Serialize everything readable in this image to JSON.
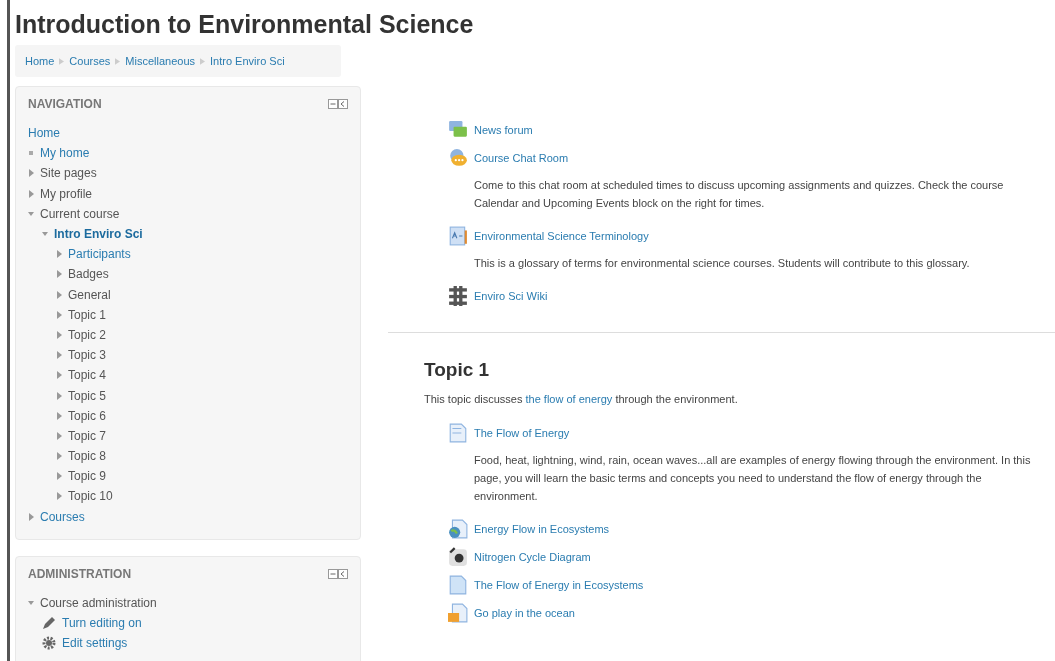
{
  "page_title": "Introduction to Environmental Science",
  "breadcrumb": [
    "Home",
    "Courses",
    "Miscellaneous",
    "Intro Enviro Sci"
  ],
  "navigation": {
    "title": "NAVIGATION",
    "items": [
      {
        "label": "Home",
        "link": true,
        "current": false
      },
      {
        "label": "My home",
        "link": true,
        "current": false
      },
      {
        "label": "Site pages",
        "link": false,
        "current": false,
        "expanded": false
      },
      {
        "label": "My profile",
        "link": false,
        "current": false,
        "expanded": false
      },
      {
        "label": "Current course",
        "link": false,
        "current": false,
        "expanded": true,
        "children": [
          {
            "label": "Intro Enviro Sci",
            "link": true,
            "current": true,
            "expanded": true,
            "children": [
              {
                "label": "Participants",
                "link": true,
                "current": false,
                "expanded": false
              },
              {
                "label": "Badges",
                "link": false,
                "current": false,
                "expanded": false
              },
              {
                "label": "General",
                "link": false,
                "current": false,
                "expanded": false
              },
              {
                "label": "Topic 1",
                "link": false,
                "current": false,
                "expanded": false
              },
              {
                "label": "Topic 2",
                "link": false,
                "current": false,
                "expanded": false
              },
              {
                "label": "Topic 3",
                "link": false,
                "current": false,
                "expanded": false
              },
              {
                "label": "Topic 4",
                "link": false,
                "current": false,
                "expanded": false
              },
              {
                "label": "Topic 5",
                "link": false,
                "current": false,
                "expanded": false
              },
              {
                "label": "Topic 6",
                "link": false,
                "current": false,
                "expanded": false
              },
              {
                "label": "Topic 7",
                "link": false,
                "current": false,
                "expanded": false
              },
              {
                "label": "Topic 8",
                "link": false,
                "current": false,
                "expanded": false
              },
              {
                "label": "Topic 9",
                "link": false,
                "current": false,
                "expanded": false
              },
              {
                "label": "Topic 10",
                "link": false,
                "current": false,
                "expanded": false
              }
            ]
          }
        ]
      },
      {
        "label": "Courses",
        "link": true,
        "current": false,
        "expanded": false
      }
    ]
  },
  "administration": {
    "title": "ADMINISTRATION",
    "items": [
      {
        "label": "Course administration",
        "expanded": true,
        "children": [
          {
            "label": "Turn editing on",
            "kind": "edit"
          },
          {
            "label": "Edit settings",
            "kind": "settings"
          }
        ]
      }
    ]
  },
  "sections": [
    {
      "activities": [
        {
          "kind": "forum",
          "name": "News forum"
        },
        {
          "kind": "chat",
          "name": "Course Chat Room",
          "description": "Come to this chat room at scheduled times to discuss upcoming assignments and quizzes. Check the course Calendar and Upcoming Events block on the right for times."
        },
        {
          "kind": "glossary",
          "name": "Environmental Science Terminology",
          "description": "This is a glossary of terms for environmental science courses. Students will contribute to this glossary."
        },
        {
          "kind": "wiki",
          "name": "Enviro Sci Wiki"
        }
      ]
    },
    {
      "title": "Topic 1",
      "summary": [
        {
          "text": "This topic discusses ",
          "link": false
        },
        {
          "text": "the flow of energy",
          "link": true
        },
        {
          "text": " through the environment.",
          "link": false
        }
      ],
      "activities": [
        {
          "kind": "page",
          "name": "The Flow of Energy",
          "description": "Food, heat, lightning, wind, rain, ocean waves...all are examples of energy flowing through the environment. In this page, you will learn the basic terms and concepts you need to understand the flow of energy through the environment."
        },
        {
          "kind": "url",
          "name": "Energy Flow in Ecosystems"
        },
        {
          "kind": "image",
          "name": "Nitrogen Cycle Diagram"
        },
        {
          "kind": "file",
          "name": "The Flow of Energy in Ecosystems"
        },
        {
          "kind": "folder",
          "name": "Go play in the ocean"
        }
      ]
    }
  ]
}
